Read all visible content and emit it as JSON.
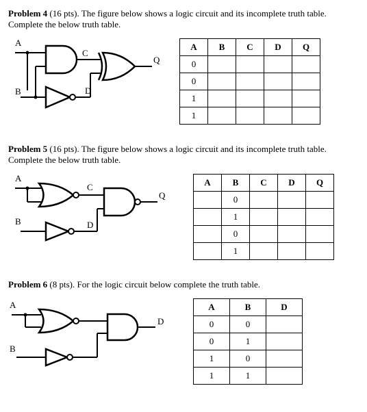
{
  "problem4": {
    "title": "Problem 4",
    "points": "(16 pts).",
    "prompt": "The figure below shows a logic circuit and its incomplete truth table. Complete the below truth table.",
    "labels": {
      "A": "A",
      "B": "B",
      "C": "C",
      "D": "D",
      "Q": "Q"
    },
    "table": {
      "headers": [
        "A",
        "B",
        "C",
        "D",
        "Q"
      ],
      "rows": [
        [
          "0",
          "",
          "",
          "",
          ""
        ],
        [
          "0",
          "",
          "",
          "",
          ""
        ],
        [
          "1",
          "",
          "",
          "",
          ""
        ],
        [
          "1",
          "",
          "",
          "",
          ""
        ]
      ]
    }
  },
  "problem5": {
    "title": "Problem 5",
    "points": "(16 pts).",
    "prompt": "The figure below shows a logic circuit and its incomplete truth table. Complete the below truth table.",
    "labels": {
      "A": "A",
      "B": "B",
      "C": "C",
      "D": "D",
      "Q": "Q"
    },
    "table": {
      "headers": [
        "A",
        "B",
        "C",
        "D",
        "Q"
      ],
      "rows": [
        [
          "",
          "0",
          "",
          "",
          ""
        ],
        [
          "",
          "1",
          "",
          "",
          ""
        ],
        [
          "",
          "0",
          "",
          "",
          ""
        ],
        [
          "",
          "1",
          "",
          "",
          ""
        ]
      ]
    }
  },
  "problem6": {
    "title": "Problem 6",
    "points": "(8 pts).",
    "prompt": "For the logic circuit below complete the truth table.",
    "labels": {
      "A": "A",
      "B": "B",
      "D": "D"
    },
    "table": {
      "headers": [
        "A",
        "B",
        "D"
      ],
      "rows": [
        [
          "0",
          "0",
          ""
        ],
        [
          "0",
          "1",
          ""
        ],
        [
          "1",
          "0",
          ""
        ],
        [
          "1",
          "1",
          ""
        ]
      ]
    }
  }
}
